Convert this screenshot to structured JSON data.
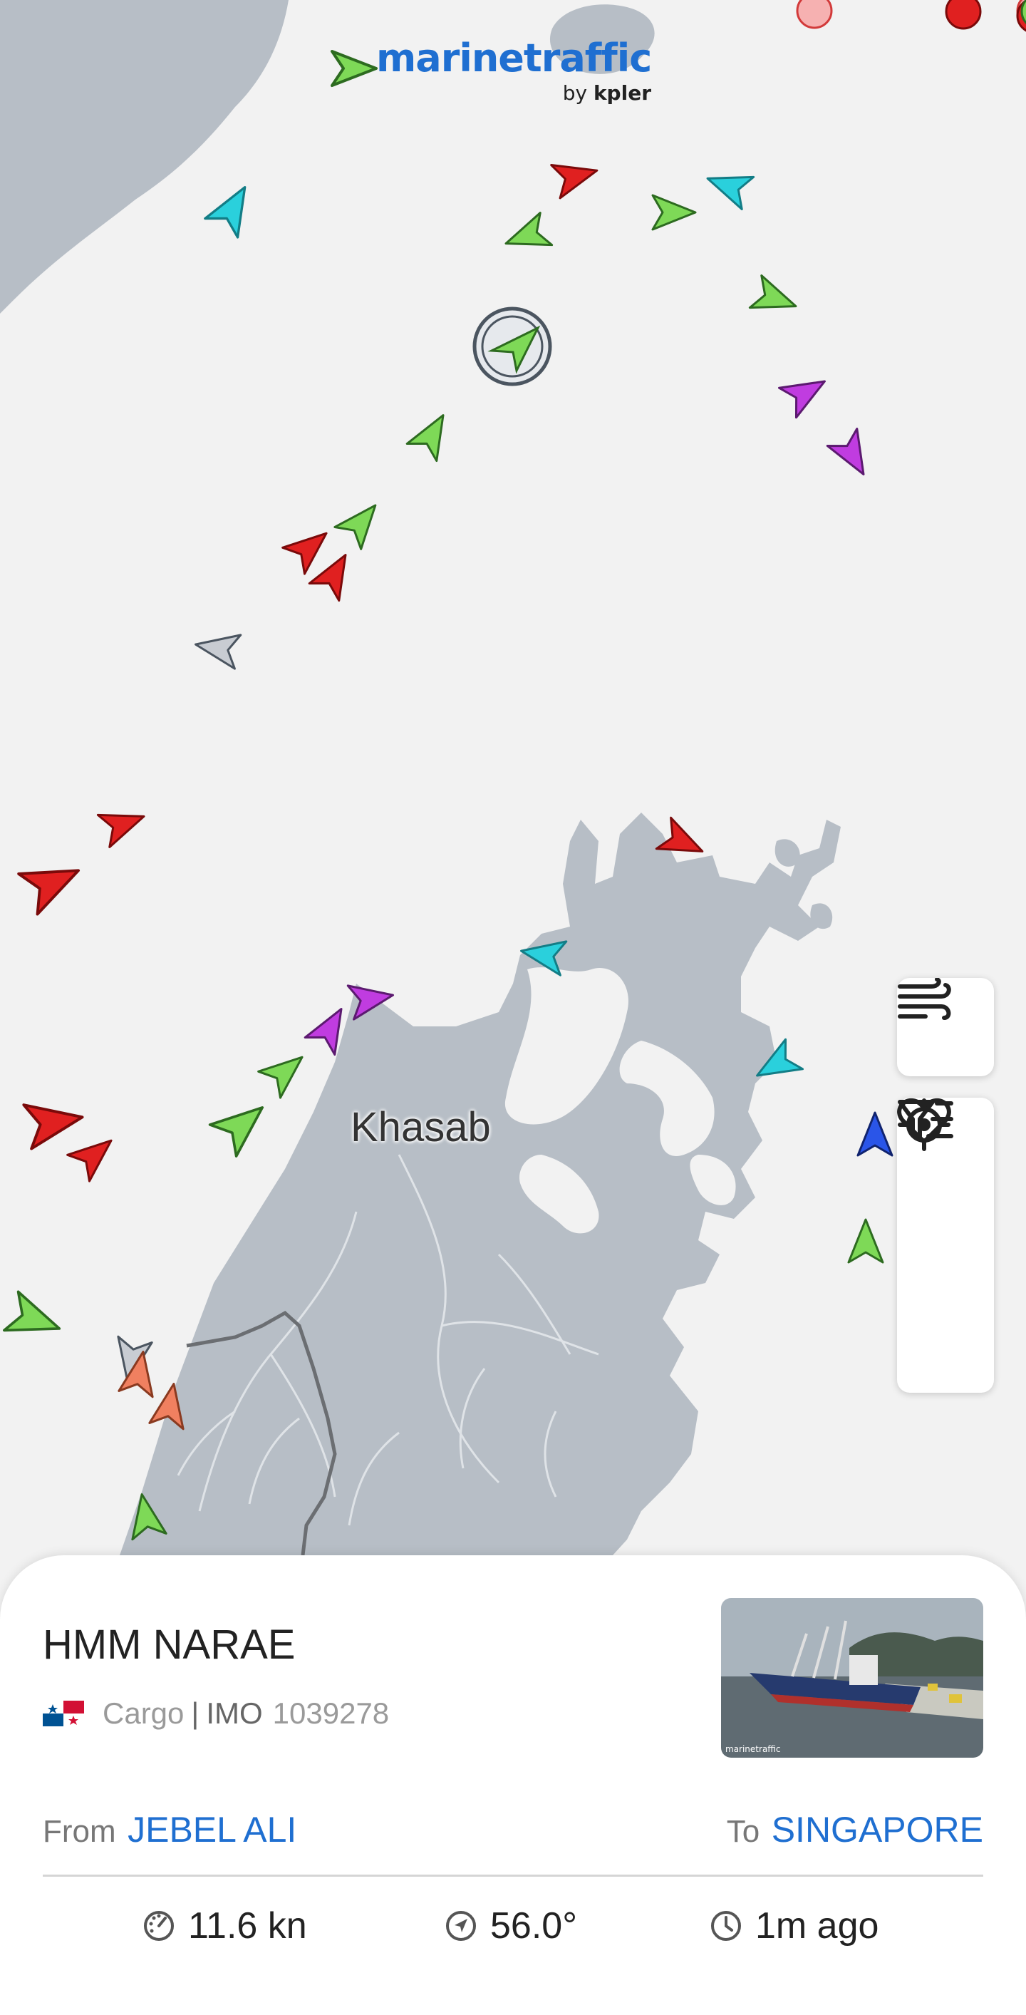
{
  "app": {
    "logo_text": "marinetraffic",
    "logo_sub_prefix": "by",
    "logo_sub_brand": "kpler"
  },
  "map": {
    "place_label": "Khasab",
    "colors": {
      "water": "#f2f2f2",
      "land": "#b7bec6",
      "cargo": "#7ed957",
      "tanker": "#e02020",
      "passenger": "#2ad0dc",
      "fishing": "#f08060",
      "pleasure": "#c03ce0",
      "unknown": "#c8ccd2",
      "highspeed": "#2a55e8"
    }
  },
  "controls": {
    "weather": "wind-icon",
    "favorites": "heart-icon",
    "filters": "filter-icon",
    "locate": "crosshair-icon"
  },
  "vessel": {
    "name": "HMM NARAE",
    "flag": "panama-flag-icon",
    "type": "Cargo",
    "separator": "|",
    "imo_label": "IMO",
    "imo": "1039278",
    "photo_watermark": "marinetraffic",
    "from_label": "From",
    "from_port": "JEBEL ALI",
    "to_label": "To",
    "to_port": "SINGAPORE",
    "speed": "11.6 kn",
    "course": "56.0°",
    "last_update": "1m ago"
  }
}
